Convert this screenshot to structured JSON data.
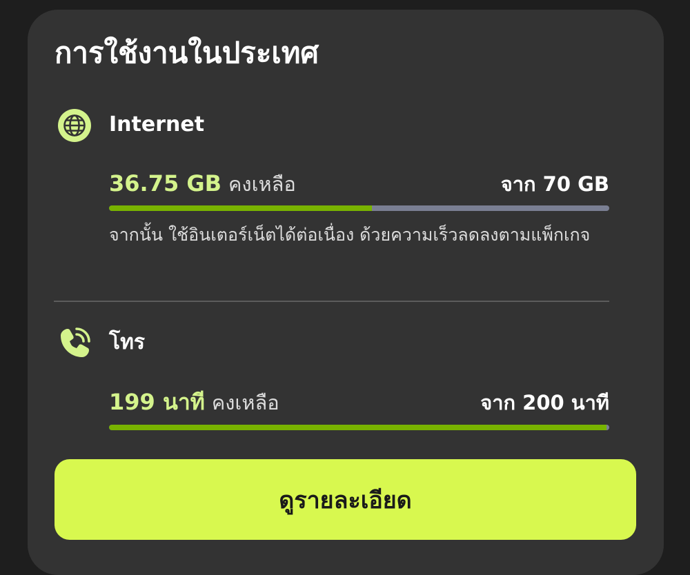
{
  "card": {
    "title": "การใช้งานในประเทศ"
  },
  "internet": {
    "label": "Internet",
    "icon": "globe-icon",
    "remaining_amount": "36.75 GB",
    "remaining_label": "คงเหลือ",
    "total": "จาก 70 GB",
    "remaining_fraction": 0.525,
    "note": "จากนั้น ใช้อินเตอร์เน็ตได้ต่อเนื่อง ด้วยความเร็วลดลงตามแพ็กเกจ"
  },
  "call": {
    "label": "โทร",
    "icon": "phone-call-icon",
    "remaining_amount": "199 นาที",
    "remaining_label": "คงเหลือ",
    "total": "จาก 200 นาที",
    "remaining_fraction": 0.995
  },
  "actions": {
    "details_label": "ดูรายละเอียด"
  },
  "colors": {
    "accent": "#d4f38c",
    "button": "#d8f84f",
    "progress_fill": "#78b300",
    "progress_track": "#7a7f93",
    "card_background": "#333333",
    "page_background": "#1e1e1e"
  }
}
